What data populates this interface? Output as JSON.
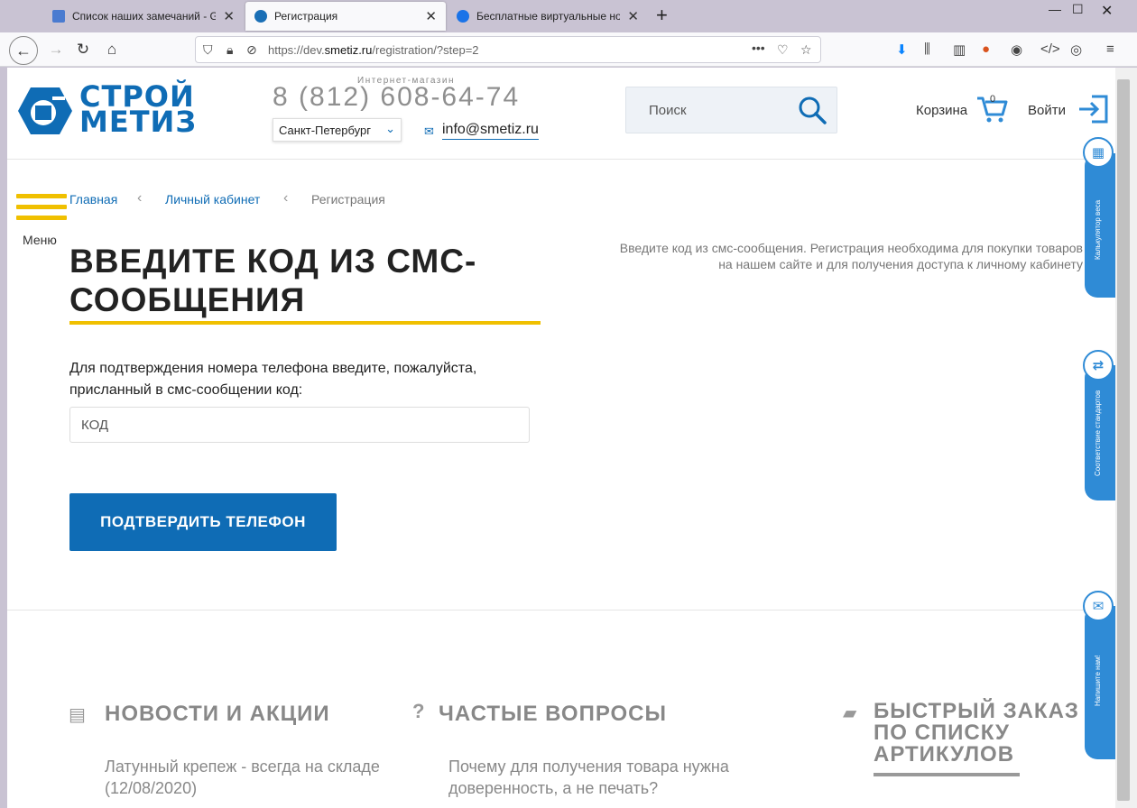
{
  "browser": {
    "tabs": [
      {
        "title": "Список наших замечаний - G",
        "color": "#4a7bd0"
      },
      {
        "title": "Регистрация",
        "color": "#1a6fb6"
      },
      {
        "title": "Бесплатные виртуальные но",
        "color": "#1a73e8"
      }
    ],
    "url_prefix": "https://dev.",
    "url_domain": "smetiz.ru",
    "url_suffix": "/registration/?step=2"
  },
  "header": {
    "logo_line1": "СТРОЙ",
    "logo_line2": "МЕТИЗ",
    "shop_label": "Интернет-магазин",
    "phone": "8 (812) 608-64-74",
    "city": "Санкт-Петербург",
    "email": "info@smetiz.ru",
    "search_placeholder": "Поиск",
    "cart_label": "Корзина",
    "cart_count": "0",
    "login_label": "Войти",
    "menu_label": "Меню"
  },
  "breadcrumbs": [
    {
      "label": "Главная"
    },
    {
      "label": "Личный кабинет"
    },
    {
      "label": "Регистрация"
    }
  ],
  "main": {
    "title": "ВВЕДИТЕ КОД ИЗ СМС-СООБЩЕНИЯ",
    "intro": "Введите код из смс-сообщения. Регистрация необходима для покупки товаров на нашем сайте и для получения доступа к личному кабинету",
    "instruction": "Для подтверждения номера телефона введите, пожалуйста, присланный в смс-сообщении код:",
    "code_placeholder": "КОД",
    "confirm_button": "ПОДТВЕРДИТЬ ТЕЛЕФОН"
  },
  "footer_sections": {
    "news_title": "НОВОСТИ И АКЦИИ",
    "news_item": "Латунный крепеж - всегда на складе (12/08/2020)",
    "faq_title": "ЧАСТЫЕ ВОПРОСЫ",
    "faq_item": "Почему для получения товара нужна доверенность, а не печать?",
    "quick_title": "БЫСТРЫЙ ЗАКАЗ ПО СПИСКУ АРТИКУЛОВ"
  },
  "side_widgets": [
    {
      "label": "Калькулятор веса"
    },
    {
      "label": "Соответствие стандартов"
    },
    {
      "label": "Напишите нам!"
    }
  ],
  "colors": {
    "brand_blue": "#0f6cb5",
    "accent_yellow": "#f0c000",
    "widget_blue": "#2f8bd6"
  }
}
